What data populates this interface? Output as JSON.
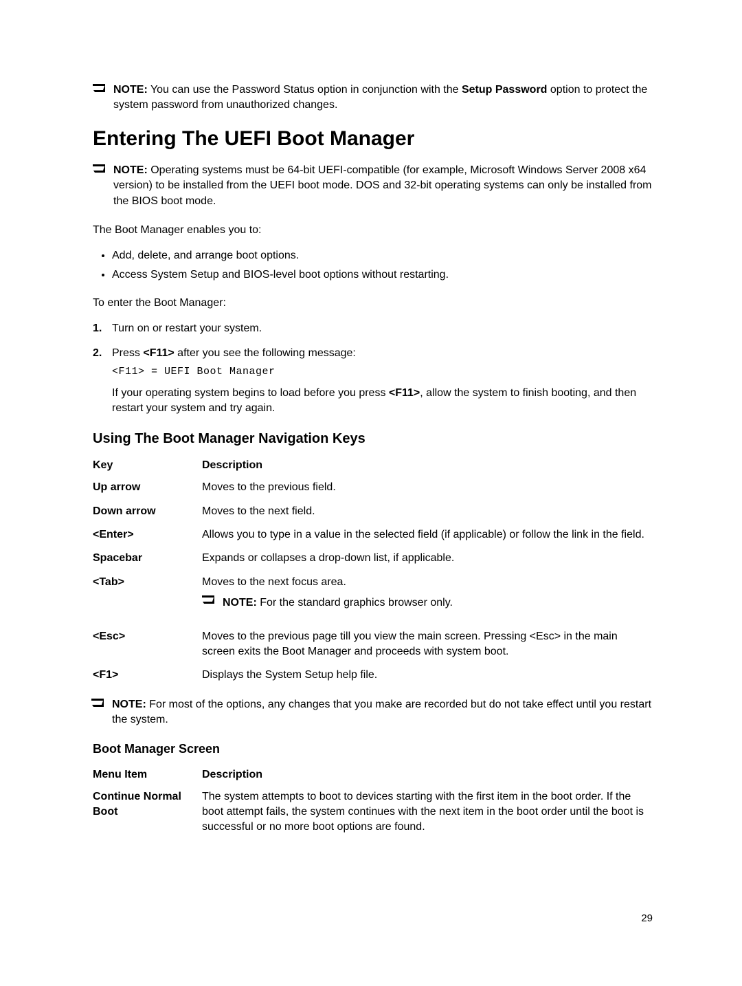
{
  "note1": {
    "label": "NOTE:",
    "text_a": " You can use the Password Status option in conjunction with the ",
    "bold_a": "Setup Password",
    "text_b": " option to protect the system password from unauthorized changes."
  },
  "heading": "Entering The UEFI Boot Manager",
  "note2": {
    "label": "NOTE:",
    "text": " Operating systems must be 64-bit UEFI-compatible (for example, Microsoft Windows Server 2008 x64 version) to be installed from the UEFI boot mode. DOS and 32-bit operating systems can only be installed from the BIOS boot mode."
  },
  "intro": "The Boot Manager enables you to:",
  "bullets": [
    "Add, delete, and arrange boot options.",
    "Access System Setup and BIOS-level boot options without restarting."
  ],
  "intro2": "To enter the Boot Manager:",
  "steps": {
    "s1_num": "1.",
    "s1_text": "Turn on or restart your system.",
    "s2_num": "2.",
    "s2_text_a": "Press ",
    "s2_bold_a": "<F11>",
    "s2_text_b": " after you see the following message:",
    "s2_mono": "<F11> = UEFI Boot Manager",
    "s2_text_c": "If your operating system begins to load before you press ",
    "s2_bold_c": "<F11>",
    "s2_text_d": ", allow the system to finish booting, and then restart your system and try again."
  },
  "sub1": "Using The Boot Manager Navigation Keys",
  "nav_table": {
    "h1": "Key",
    "h2": "Description",
    "rows": [
      {
        "key": "Up arrow",
        "desc": "Moves to the previous field."
      },
      {
        "key": "Down arrow",
        "desc": "Moves to the next field."
      },
      {
        "key": "<Enter>",
        "desc": "Allows you to type in a value in the selected field (if applicable) or follow the link in the field."
      },
      {
        "key": "Spacebar",
        "desc": "Expands or collapses a drop-down list, if applicable."
      },
      {
        "key": "<Tab>",
        "desc": "Moves to the next focus area."
      },
      {
        "key": "<Esc>",
        "desc": "Moves to the previous page till you view the main screen. Pressing <Esc> in the main screen exits the Boot Manager and proceeds with system boot."
      },
      {
        "key": "<F1>",
        "desc": "Displays the System Setup help file."
      }
    ],
    "tab_note_label": "NOTE:",
    "tab_note_text": " For the standard graphics browser only."
  },
  "note3": {
    "label": "NOTE:",
    "text": " For most of the options, any changes that you make are recorded but do not take effect until you restart the system."
  },
  "sub2": "Boot Manager Screen",
  "menu_table": {
    "h1": "Menu Item",
    "h2": "Description",
    "rows": [
      {
        "key": "Continue Normal Boot",
        "desc": "The system attempts to boot to devices starting with the first item in the boot order. If the boot attempt fails, the system continues with the next item in the boot order until the boot is successful or no more boot options are found."
      }
    ]
  },
  "page_number": "29"
}
